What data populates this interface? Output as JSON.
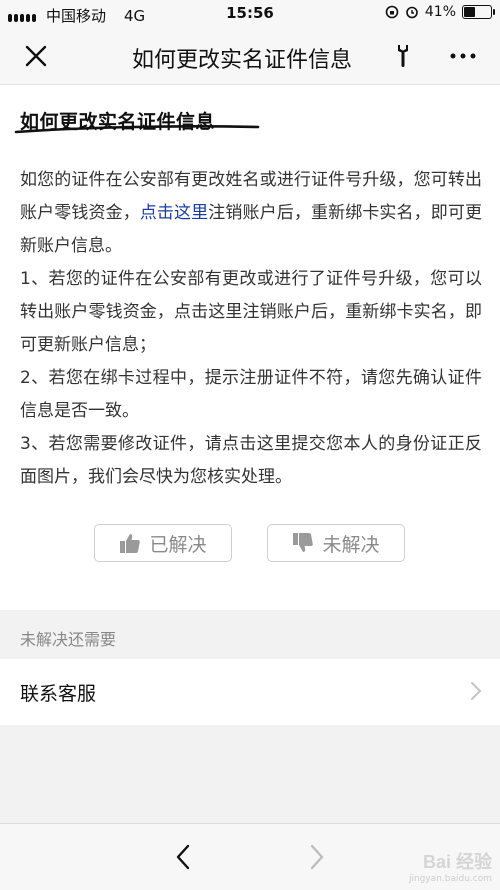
{
  "status_bar": {
    "carrier": "中国移动",
    "network": "4G",
    "time": "15:56",
    "battery": "41%",
    "battery_level": 0.41
  },
  "nav": {
    "title": "如何更改实名证件信息",
    "close_icon": "close-icon",
    "wrench_icon": "wrench-icon",
    "more_icon": "more-icon"
  },
  "article": {
    "title": "如何更改实名证件信息",
    "intro_before_link": "如您的证件在公安部有更改姓名或进行证件号升级，您可转出账户零钱资金，",
    "intro_link": "点击这里",
    "intro_after_link": "注销账户后，重新绑卡实名，即可更新账户信息。",
    "items": [
      "1、若您的证件在公安部有更改或进行了证件号升级，您可以转出账户零钱资金，点击这里注销账户后，重新绑卡实名，即可更新账户信息；",
      "2、若您在绑卡过程中，提示注册证件不符，请您先确认证件信息是否一致。",
      "3、若您需要修改证件，请点击这里提交您本人的身份证正反面图片，我们会尽快为您核实处理。"
    ],
    "link_color": "#1a3ca8"
  },
  "feedback": {
    "solved_label": "已解决",
    "unsolved_label": "未解决",
    "solved_icon": "thumbs-up-icon",
    "unsolved_icon": "thumbs-down-icon"
  },
  "help": {
    "section_label": "未解决还需要",
    "contact_label": "联系客服"
  },
  "bottom_nav": {
    "back_icon": "chevron-left-icon",
    "forward_icon": "chevron-right-icon"
  },
  "watermark": {
    "logo": "Bai 经验",
    "url": "jingyan.baidu.com"
  }
}
